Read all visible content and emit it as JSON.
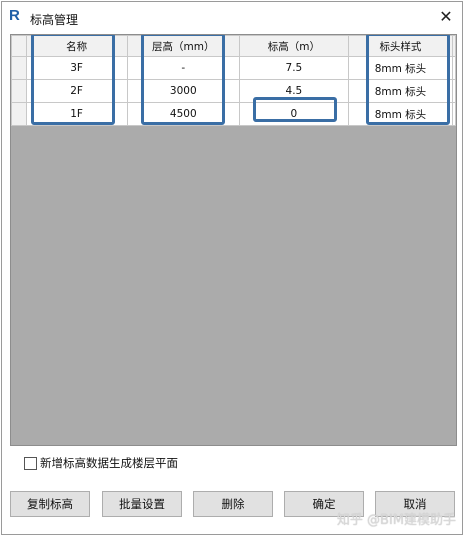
{
  "window": {
    "logo_letter": "R",
    "title": "标高管理",
    "close_glyph": "✕"
  },
  "table": {
    "headers": [
      "名称",
      "层高（mm）",
      "标高（m）",
      "标头样式"
    ],
    "rows": [
      {
        "name": "3F",
        "height": "-",
        "elevation": "7.5",
        "style": "8mm 标头"
      },
      {
        "name": "2F",
        "height": "3000",
        "elevation": "4.5",
        "style": "8mm 标头"
      },
      {
        "name": "1F",
        "height": "4500",
        "elevation": "0",
        "style": "8mm 标头"
      }
    ]
  },
  "options": {
    "generate_floorplans_label": "新增标高数据生成楼层平面",
    "generate_floorplans_checked": false
  },
  "buttons": {
    "copy": "复制标高",
    "batch": "批量设置",
    "delete": "删除",
    "ok": "确定",
    "cancel": "取消"
  },
  "watermark": "知乎 @BIM建模助手",
  "colors": {
    "highlight": "#3a6ea5",
    "logo": "#1f5fa8",
    "empty_area": "#ababab"
  }
}
